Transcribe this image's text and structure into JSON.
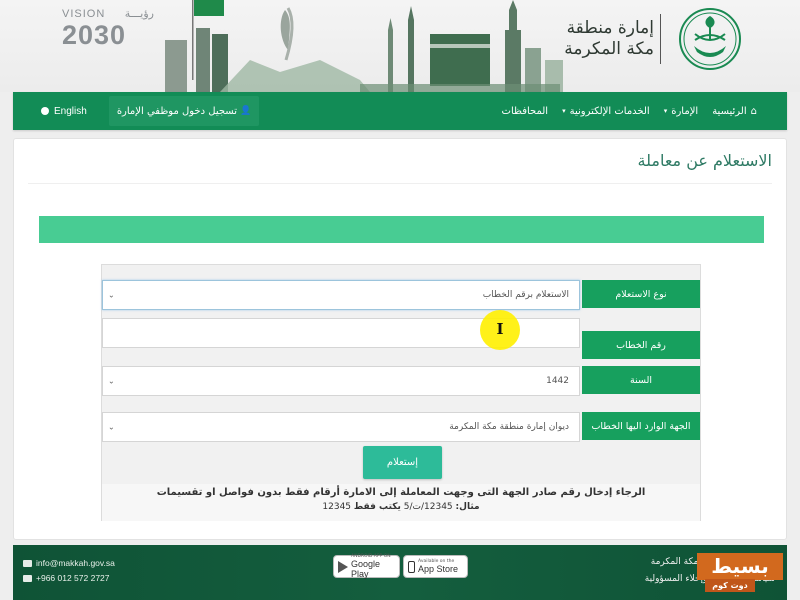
{
  "header": {
    "vision_label": "VISION",
    "vision_arabic": "رؤيـــة",
    "vision_year": "2030",
    "title_line1": "إمارة منطقة",
    "title_line2": "مكة المكرمة",
    "emblem_icon": "saudi-emblem-icon"
  },
  "nav": {
    "items": [
      {
        "label": "الرئيسية",
        "icon": "home-icon",
        "dropdown": false
      },
      {
        "label": "الإمارة",
        "dropdown": true
      },
      {
        "label": "الخدمات الإلكترونية",
        "dropdown": true
      },
      {
        "label": "المحافظات",
        "dropdown": false
      }
    ],
    "login_label": "تسجيل دخول موظفي الإمارة",
    "login_icon": "user-icon",
    "language_label": "English",
    "language_icon": "globe-icon",
    "caret": "▾"
  },
  "main": {
    "page_title": "الاستعلام عن معاملة",
    "alert_color": "#48cc93",
    "form": {
      "inquiry_type": {
        "label": "نوع الاستعلام",
        "value": "الاستعلام برقم الخطاب"
      },
      "letter_number": {
        "label": "رقم الخطاب",
        "value": ""
      },
      "year": {
        "label": "السنة",
        "value": "1442"
      },
      "recipient": {
        "label": "الجهة الوارد اليها الخطاب",
        "value": "ديوان إمارة منطقة مكة المكرمة"
      },
      "submit_label": "إستعلام",
      "chevron": "⌄"
    },
    "hint_line1": "الرجاء إدخال رقم صادر الجهة التى وجهت المعاملة إلى الامارة أرقام فقط بدون فواصل او تقسيمات",
    "hint_example_label": "مثال:",
    "hint_example_value": "12345/ت/5",
    "hint_example_middle": "يكتب فقط",
    "hint_example_result": "12345"
  },
  "cursor": {
    "glyph": "I"
  },
  "footer": {
    "email": "info@makkah.gov.sa",
    "phone": "+966 012 572 2727",
    "google_play_small": "ANDROID APP ON",
    "google_play_label": "Google Play",
    "app_store_small": "Available on the",
    "app_store_label": "App Store",
    "right_line1": "ماجد بن عبدالعزيز - مكة المكرمة",
    "right_line2": "سياسة الإستخدام وإخلاء المسؤولية"
  },
  "watermark": {
    "top": "بسيط",
    "bottom": "دوت كوم"
  },
  "colors": {
    "nav_green": "#128c56",
    "label_green": "#17a05e",
    "button_teal": "#2dbb99",
    "footer_green": "#145e3e",
    "title_color": "#2e7a64"
  }
}
